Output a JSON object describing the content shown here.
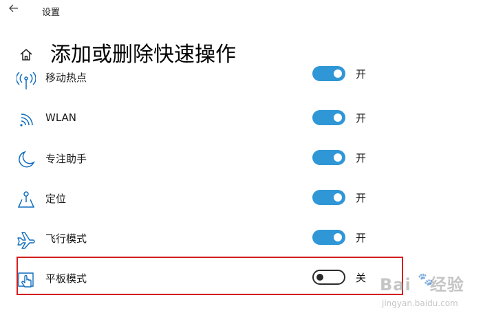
{
  "window": {
    "app_title": "设置"
  },
  "header": {
    "title": "添加或删除快速操作"
  },
  "items": [
    {
      "label": "移动热点",
      "icon": "mobile-hotspot-icon",
      "state": "开",
      "on": true
    },
    {
      "label": "WLAN",
      "icon": "wifi-icon",
      "state": "开",
      "on": true
    },
    {
      "label": "专注助手",
      "icon": "moon-icon",
      "state": "开",
      "on": true
    },
    {
      "label": "定位",
      "icon": "location-icon",
      "state": "开",
      "on": true
    },
    {
      "label": "飞行模式",
      "icon": "airplane-icon",
      "state": "开",
      "on": true
    },
    {
      "label": "平板模式",
      "icon": "tablet-mode-icon",
      "state": "关",
      "on": false
    }
  ],
  "watermark": {
    "main": "Bai",
    "main2": "经验",
    "sub": "jingyan.baidu.com"
  },
  "colors": {
    "accent": "#2f97d6",
    "icon": "#0f6cbd",
    "highlight": "#d31f1f"
  }
}
